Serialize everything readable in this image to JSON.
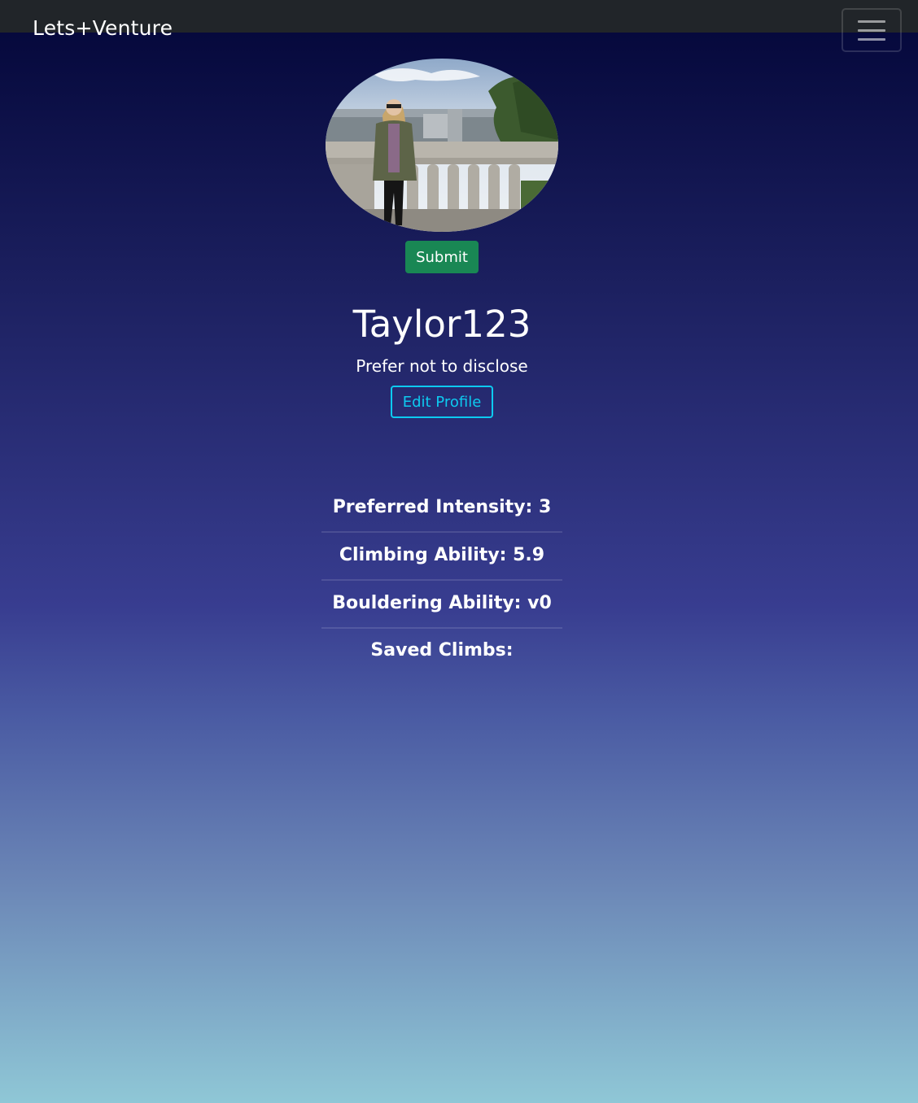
{
  "navbar": {
    "brand": "Lets+Venture",
    "toggler_icon": "hamburger-menu-icon"
  },
  "profile": {
    "avatar_image": "profile-photo",
    "submit_label": "Submit",
    "username": "Taylor123",
    "pronouns": "Prefer not to disclose",
    "edit_label": "Edit Profile"
  },
  "stats": [
    {
      "label": "Preferred Intensity: 3"
    },
    {
      "label": "Climbing Ability: 5.9"
    },
    {
      "label": "Bouldering Ability: v0"
    },
    {
      "label": "Saved Climbs:"
    }
  ],
  "colors": {
    "navbar_bg": "#212529",
    "submit_bg": "#198754",
    "edit_outline": "#0dcaf0",
    "gradient_top": "#030638",
    "gradient_bottom": "#8fc7d6"
  }
}
